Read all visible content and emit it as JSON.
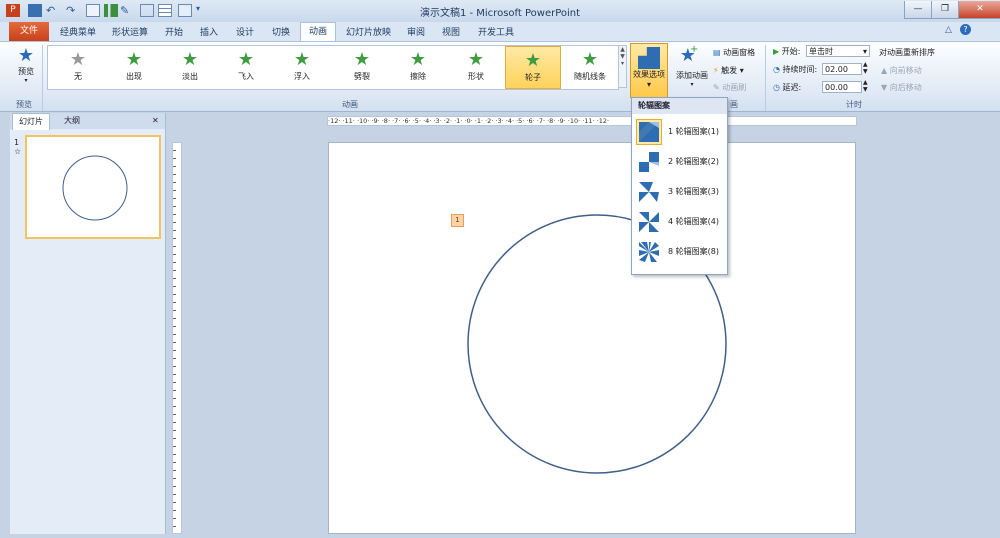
{
  "window": {
    "title": "演示文稿1 - Microsoft PowerPoint",
    "minimize": "—",
    "restore": "❐",
    "close": "✕"
  },
  "tabs": {
    "file": "文件",
    "items": [
      "经典菜单",
      "形状运算",
      "开始",
      "插入",
      "设计",
      "切换",
      "动画",
      "幻灯片放映",
      "审阅",
      "视图",
      "开发工具"
    ],
    "active": "动画"
  },
  "ribbon": {
    "preview": {
      "label": "预览",
      "group": "预览"
    },
    "gallery": {
      "group": "动画",
      "items": [
        "无",
        "出现",
        "淡出",
        "飞入",
        "浮入",
        "劈裂",
        "擦除",
        "形状",
        "轮子",
        "随机线条"
      ],
      "selected": "轮子"
    },
    "effect_options": "效果选项",
    "add_animation": "添加动画",
    "advanced": {
      "pane": "动画窗格",
      "trigger": "触发",
      "painter": "动画刷",
      "group": "画"
    },
    "timing": {
      "group": "计时",
      "start_label": "开始:",
      "start_value": "单击时",
      "duration_label": "持续时间:",
      "duration_value": "02.00",
      "delay_label": "延迟:",
      "delay_value": "00.00",
      "reorder": "对动画重新排序",
      "move_earlier": "向前移动",
      "move_later": "向后移动"
    }
  },
  "slide_pane": {
    "tab_slides": "幻灯片",
    "tab_outline": "大纲",
    "close": "✕",
    "slide_number": "1",
    "star": "☆"
  },
  "ruler": {
    "text": "·12·  ·11·  ·10·  ·9·  ·8·  ·7·  ·6·  ·5·  ·4·  ·3·  ·2·  ·1·  ·0·  ·1·  ·2·  ·3·  ·4·  ·5·  ·6·  ·7·  ·8·  ·9·  ·10·  ·11·  ·12·"
  },
  "slide": {
    "anim_tag": "1"
  },
  "dropdown": {
    "header": "轮辐图案",
    "items": [
      "1 轮辐图案(1)",
      "2 轮辐图案(2)",
      "3 轮辐图案(3)",
      "4 轮辐图案(4)",
      "8 轮辐图案(8)"
    ],
    "selected_index": 0
  },
  "colors": {
    "accent_blue": "#2e6db1",
    "selection_gold": "#ffd35a",
    "file_tab": "#c8401a",
    "shape_stroke": "#3f5f8a"
  }
}
